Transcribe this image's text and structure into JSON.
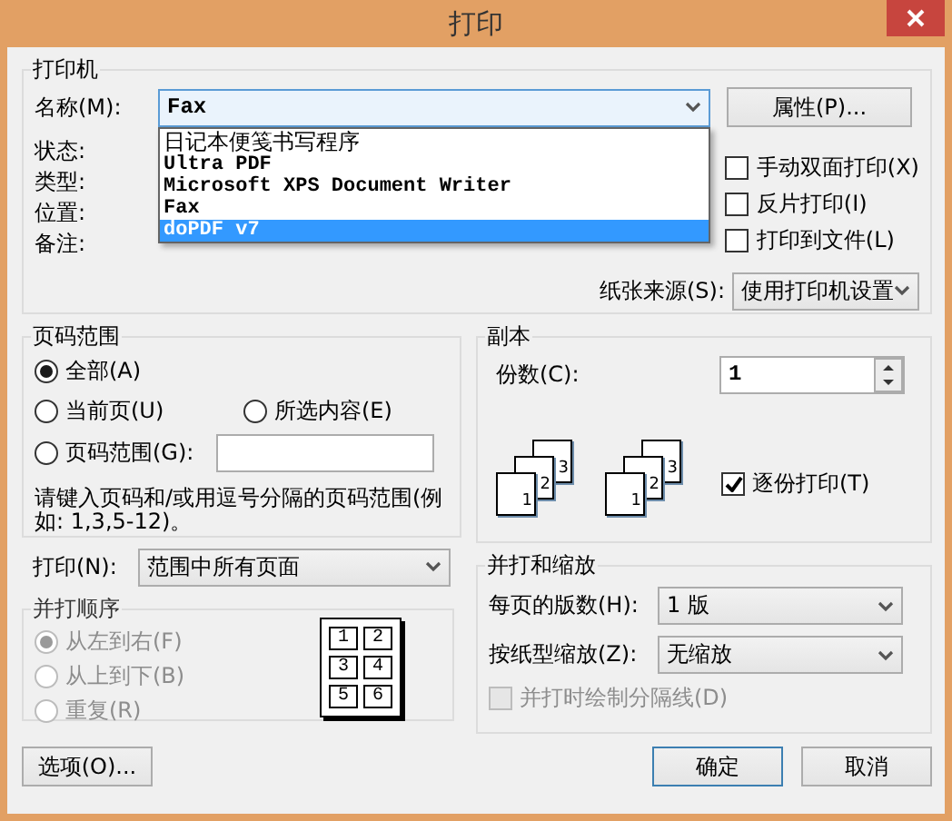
{
  "window": {
    "title": "打印"
  },
  "printer": {
    "title": "打印机",
    "name_label": "名称(M):",
    "name_value": "Fax",
    "dropdown_open": true,
    "options": [
      {
        "label": "日记本便笺书写程序",
        "selected": false
      },
      {
        "label": "Ultra PDF",
        "selected": false
      },
      {
        "label": "Microsoft XPS Document Writer",
        "selected": false
      },
      {
        "label": "Fax",
        "selected": false
      },
      {
        "label": "doPDF v7",
        "selected": true
      }
    ],
    "properties_button": "属性(P)...",
    "info_labels": [
      "状态:",
      "类型:",
      "位置:",
      "备注:"
    ],
    "checkboxes": [
      {
        "label": "手动双面打印(X)",
        "checked": false
      },
      {
        "label": "反片打印(I)",
        "checked": false
      },
      {
        "label": "打印到文件(L)",
        "checked": false
      }
    ],
    "paper_source_label": "纸张来源(S):",
    "paper_source_value": "使用打印机设置"
  },
  "page_range": {
    "title": "页码范围",
    "options": [
      {
        "label": "全部(A)",
        "selected": true
      },
      {
        "label": "当前页(U)",
        "selected": false
      },
      {
        "label": "所选内容(E)",
        "selected": false
      },
      {
        "label": "页码范围(G):",
        "selected": false
      }
    ],
    "hint": "请键入页码和/或用逗号分隔的页码范围(例如: 1,3,5-12)。"
  },
  "copies": {
    "title": "副本",
    "count_label": "份数(C):",
    "count_value": "1",
    "stacks": [
      [
        "1",
        "2",
        "3"
      ],
      [
        "1",
        "2",
        "3"
      ]
    ],
    "collate": {
      "label": "逐份打印(T)",
      "checked": true
    }
  },
  "print_what": {
    "label": "打印(N):",
    "value": "范围中所有页面"
  },
  "order": {
    "title": "并打顺序",
    "disabled": true,
    "options": [
      {
        "label": "从左到右(F)",
        "selected": true
      },
      {
        "label": "从上到下(B)",
        "selected": false
      },
      {
        "label": "重复(R)",
        "selected": false
      }
    ],
    "preview": [
      "1",
      "2",
      "3",
      "4",
      "5",
      "6"
    ]
  },
  "scaling": {
    "title": "并打和缩放",
    "pages_label": "每页的版数(H):",
    "pages_value": "1 版",
    "scale_label": "按纸型缩放(Z):",
    "scale_value": "无缩放",
    "separator": {
      "label": "并打时绘制分隔线(D)",
      "checked": false,
      "disabled": true
    }
  },
  "buttons": {
    "options": "选项(O)...",
    "ok": "确定",
    "cancel": "取消"
  }
}
